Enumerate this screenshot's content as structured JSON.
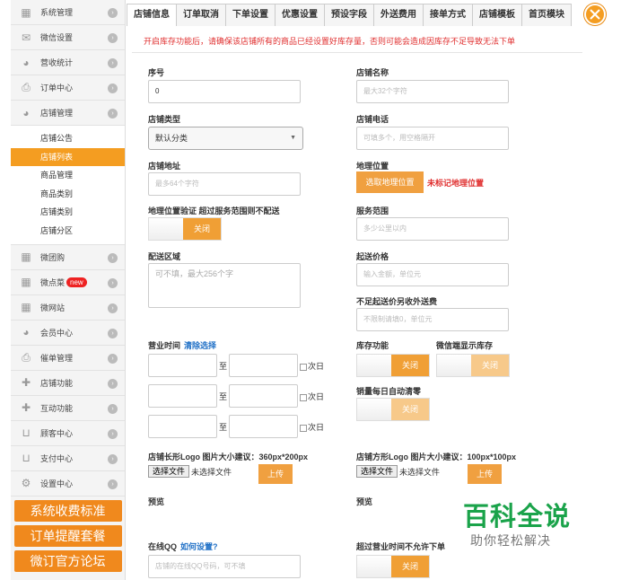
{
  "sidebar": {
    "items_top": [
      {
        "label": "系统管理",
        "icon": "grid-icon"
      },
      {
        "label": "微信设置",
        "icon": "envelope-icon"
      },
      {
        "label": "营收统计",
        "icon": "pie-chart-icon"
      },
      {
        "label": "订单中心",
        "icon": "printer-icon"
      },
      {
        "label": "店铺管理",
        "icon": "pie-chart-icon"
      }
    ],
    "sub_items": [
      {
        "label": "店铺公告"
      },
      {
        "label": "店铺列表"
      },
      {
        "label": "商品管理"
      },
      {
        "label": "商品类别"
      },
      {
        "label": "店铺类别"
      },
      {
        "label": "店铺分区"
      }
    ],
    "items_bottom": [
      {
        "label": "微团购",
        "icon": "grid-icon"
      },
      {
        "label": "微点菜",
        "icon": "grid-icon",
        "badge": "new"
      },
      {
        "label": "微网站",
        "icon": "grid-icon"
      },
      {
        "label": "会员中心",
        "icon": "pie-chart-icon"
      },
      {
        "label": "催单管理",
        "icon": "printer-icon"
      },
      {
        "label": "店铺功能",
        "icon": "plus-icon"
      },
      {
        "label": "互动功能",
        "icon": "plus-icon"
      },
      {
        "label": "顾客中心",
        "icon": "inbox-icon"
      },
      {
        "label": "支付中心",
        "icon": "inbox-icon"
      },
      {
        "label": "设置中心",
        "icon": "gear-icon"
      }
    ],
    "buttons": [
      "系统收费标准",
      "订单提醒套餐",
      "微订官方论坛"
    ]
  },
  "tabs": [
    "店铺信息",
    "订单取消",
    "下单设置",
    "优惠设置",
    "预设字段",
    "外送费用",
    "接单方式",
    "店铺模板",
    "首页模块"
  ],
  "warning": "开启库存功能后，请确保该店铺所有的商品已经设置好库存量，否则可能会造成因库存不足导致无法下单",
  "form": {
    "seq_label": "序号",
    "seq_value": "0",
    "store_name_label": "店铺名称",
    "store_name_placeholder": "最大32个字符",
    "store_type_label": "店铺类型",
    "store_type_value": "默认分类",
    "store_phone_label": "店铺电话",
    "store_phone_placeholder": "可填多个，用空格隔开",
    "address_label": "店铺地址",
    "address_placeholder": "最多64个字符",
    "geo_label": "地理位置",
    "geo_button": "选取地理位置",
    "geo_warning": "未标记地理位置",
    "geo_verify_label": "地理位置验证 超过服务范围则不配送",
    "toggle_off": "关闭",
    "service_range_label": "服务范围",
    "service_range_placeholder": "多少公里以内",
    "delivery_area_label": "配送区域",
    "delivery_area_placeholder": "可不填，最大256个字",
    "min_price_label": "起送价格",
    "min_price_placeholder": "输入金额，单位元",
    "extra_fee_label": "不足起送价另收外送费",
    "extra_fee_placeholder": "不限制请填0，单位元",
    "hours_label": "营业时间",
    "hours_clear": "清除选择",
    "hours_to": "至",
    "next_day": "次日",
    "stock_label": "库存功能",
    "wechat_stock_label": "微信端显示库存",
    "daily_reset_label": "销量每日自动清零",
    "long_logo_label": "店铺长形Logo 图片大小建议：360px*200px",
    "square_logo_label": "店铺方形Logo 图片大小建议：100px*100px",
    "choose_file": "选择文件",
    "no_file": "未选择文件",
    "upload": "上传",
    "preview": "预览",
    "qq_label": "在线QQ",
    "qq_help": "如何设置?",
    "qq_placeholder": "店铺的在线QQ号码，可不填",
    "no_order_label": "超过营业时间不允许下单"
  },
  "watermark": {
    "title": "百科全说",
    "subtitle": "助你轻松解决"
  },
  "colors": {
    "accent": "#f0891d",
    "active_sub": "#f49d21",
    "warning": "#e03030",
    "link": "#1e6fc6",
    "watermark": "#1aa34a"
  }
}
